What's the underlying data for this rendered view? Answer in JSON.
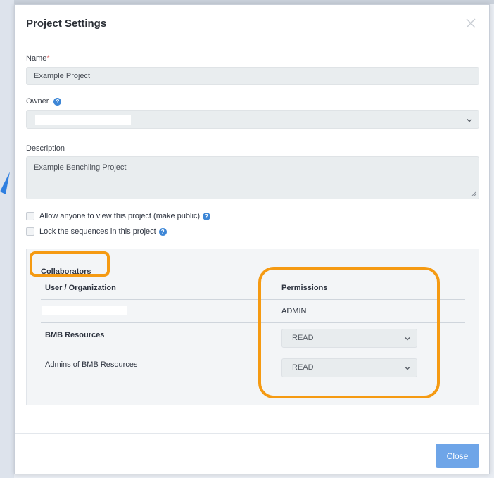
{
  "dialog": {
    "title": "Project Settings"
  },
  "form": {
    "name_label": "Name",
    "name_required_mark": "*",
    "name_value": "Example Project",
    "owner_label": "Owner",
    "description_label": "Description",
    "description_value": "Example Benchling Project",
    "public_checkbox_label": "Allow anyone to view this project (make public)",
    "lock_checkbox_label": "Lock the sequences in this project",
    "help_glyph": "?"
  },
  "collaborators": {
    "heading": "Collaborators",
    "col_user": "User / Organization",
    "col_permissions": "Permissions",
    "rows": [
      {
        "name": "",
        "permission": "ADMIN"
      },
      {
        "name": "BMB Resources",
        "permission": "READ"
      },
      {
        "name": "Admins of BMB Resources",
        "permission": "READ"
      }
    ]
  },
  "footer": {
    "close_label": "Close"
  },
  "colors": {
    "highlight": "#f59a12",
    "primary_button": "#6ea5e8",
    "help_icon": "#3d86d6"
  }
}
